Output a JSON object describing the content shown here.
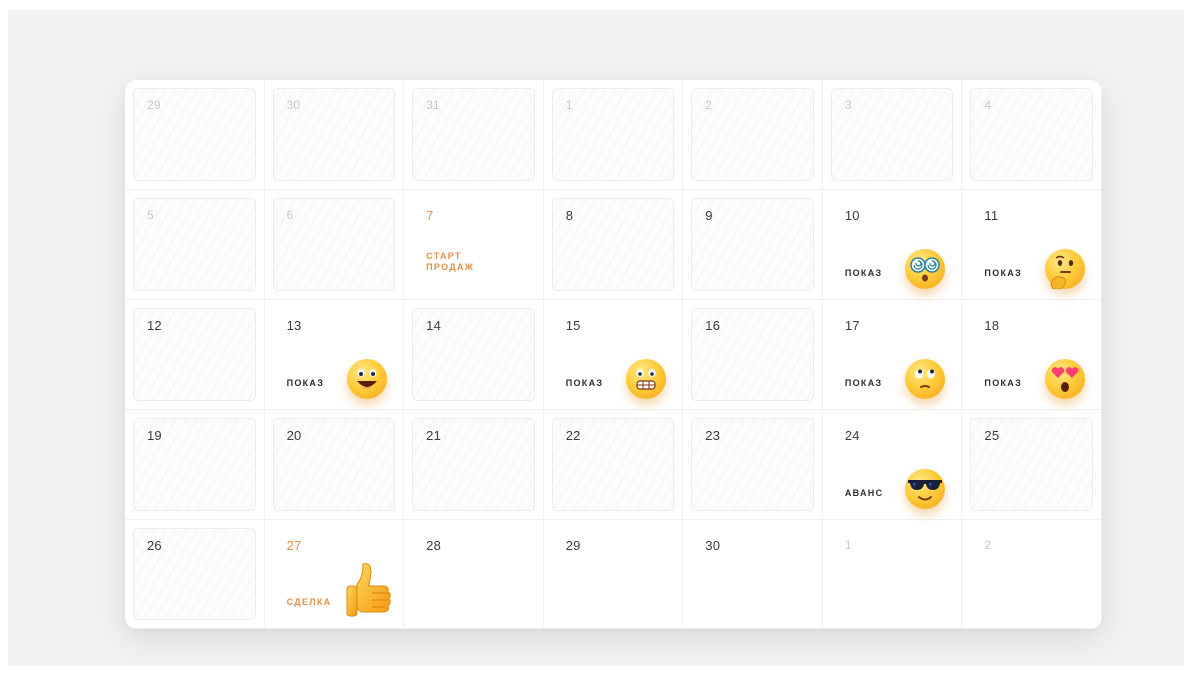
{
  "calendar": {
    "weeks": [
      [
        {
          "day": "29",
          "faded": true
        },
        {
          "day": "30",
          "faded": true
        },
        {
          "day": "31",
          "faded": true
        },
        {
          "day": "1",
          "faded": true
        },
        {
          "day": "2",
          "faded": true
        },
        {
          "day": "3",
          "faded": true
        },
        {
          "day": "4",
          "faded": true
        }
      ],
      [
        {
          "day": "5",
          "faded": true
        },
        {
          "day": "6",
          "faded": true
        },
        {
          "day": "7",
          "event": "СТАРТ ПРОДАЖ",
          "accent": true
        },
        {
          "day": "8"
        },
        {
          "day": "9"
        },
        {
          "day": "10",
          "event": "ПОКАЗ",
          "icon": "dizzy-face-emoji-icon"
        },
        {
          "day": "11",
          "event": "ПОКАЗ",
          "icon": "thinking-face-emoji-icon"
        }
      ],
      [
        {
          "day": "12"
        },
        {
          "day": "13",
          "event": "ПОКАЗ",
          "icon": "grinning-face-emoji-icon"
        },
        {
          "day": "14"
        },
        {
          "day": "15",
          "event": "ПОКАЗ",
          "icon": "grimacing-face-emoji-icon"
        },
        {
          "day": "16"
        },
        {
          "day": "17",
          "event": "ПОКАЗ",
          "icon": "eye-roll-face-emoji-icon"
        },
        {
          "day": "18",
          "event": "ПОКАЗ",
          "icon": "heart-eyes-face-emoji-icon"
        }
      ],
      [
        {
          "day": "19"
        },
        {
          "day": "20"
        },
        {
          "day": "21"
        },
        {
          "day": "22"
        },
        {
          "day": "23"
        },
        {
          "day": "24",
          "event": "АВАНС",
          "icon": "sunglasses-face-emoji-icon"
        },
        {
          "day": "25"
        }
      ],
      [
        {
          "day": "26"
        },
        {
          "day": "27",
          "event": "СДЕЛКА",
          "accent": true,
          "icon": "thumbs-up-emoji-icon"
        },
        {
          "day": "28"
        },
        {
          "day": "29"
        },
        {
          "day": "30"
        },
        {
          "day": "1",
          "faded": true
        },
        {
          "day": "2",
          "faded": true
        }
      ]
    ]
  },
  "colors": {
    "accent": "#e0904a",
    "text": "#3b3b3b",
    "faded_text": "#c8c8c8",
    "background": "#f1f2f2",
    "card": "#ffffff"
  }
}
